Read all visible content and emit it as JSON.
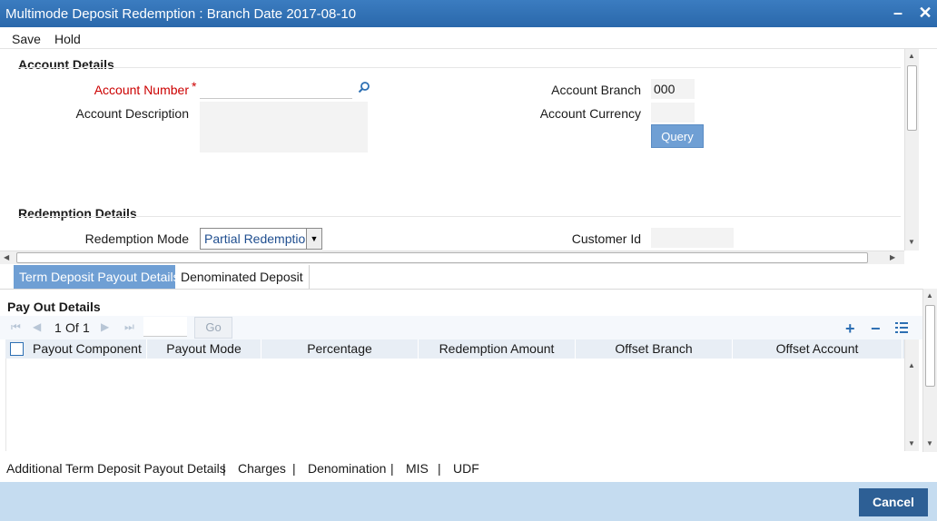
{
  "window": {
    "title": "Multimode Deposit Redemption : Branch Date 2017-08-10",
    "minimize_label": "–",
    "close_label": "✕"
  },
  "menu": {
    "save_label": "Save",
    "hold_label": "Hold"
  },
  "account_details": {
    "section_title": "Account Details",
    "account_number_label": "Account Number",
    "required_mark": "*",
    "account_number_value": "",
    "account_description_label": "Account Description",
    "account_description_value": "",
    "account_branch_label": "Account Branch",
    "account_branch_value": "000",
    "account_currency_label": "Account Currency",
    "account_currency_value": "",
    "query_label": "Query"
  },
  "redemption_details": {
    "section_title": "Redemption Details",
    "redemption_mode_label": "Redemption Mode",
    "redemption_mode_value": "Partial Redemption",
    "customer_id_label": "Customer Id",
    "customer_id_value": ""
  },
  "tabs": [
    {
      "label": "Term Deposit Payout Details",
      "active": true
    },
    {
      "label": "Denominated Deposit",
      "active": false
    }
  ],
  "payout": {
    "section_title": "Pay Out Details",
    "pagination": {
      "current": "1",
      "of_label": "Of",
      "total": "1"
    },
    "go_label": "Go",
    "columns": [
      "Payout Component",
      "Payout Mode",
      "Percentage",
      "Redemption Amount",
      "Offset Branch",
      "Offset Account"
    ],
    "rows": []
  },
  "footer_links": [
    "Additional Term Deposit Payout Details",
    "Charges",
    "Denomination",
    "MIS",
    "UDF"
  ],
  "footer_separator": "|",
  "cancel_label": "Cancel",
  "colors": {
    "titlebar": "#2d6fb3",
    "accent_tab": "#6f9fd4",
    "required": "#cc0000",
    "cancel_button": "#2d5f95",
    "bottom_bar": "#c5dcf0"
  }
}
